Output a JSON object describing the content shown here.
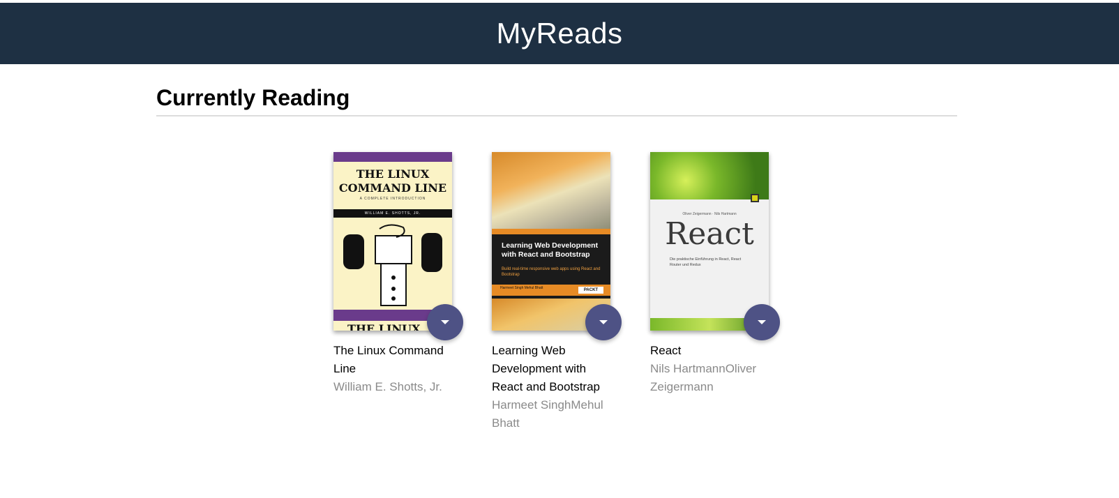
{
  "header": {
    "title": "MyReads"
  },
  "shelf": {
    "title": "Currently Reading",
    "books": [
      {
        "title": "The Linux Command Line",
        "authors": "William E. Shotts, Jr.",
        "cover": {
          "title_line1": "THE LINUX",
          "title_line2": "COMMAND LINE",
          "subtitle": "A COMPLETE INTRODUCTION",
          "author": "WILLIAM E. SHOTTS, JR.",
          "peek": "THE LINUX"
        }
      },
      {
        "title": "Learning Web Development with React and Bootstrap",
        "authors": "Harmeet SinghMehul Bhatt",
        "cover": {
          "title": "Learning Web Development with React and Bootstrap",
          "desc": "Build real-time responsive web apps using React and Bootstrap",
          "authors": "Harmeet Singh Mehul Bhatt",
          "publisher": "PACKT"
        }
      },
      {
        "title": "React",
        "authors": "Nils HartmannOliver Zeigermann",
        "cover": {
          "authors": "Oliver Zeigermann · Nils Hartmann",
          "title": "React",
          "desc": "Die praktische Einführung in React, React Router und Redux"
        }
      }
    ]
  },
  "colors": {
    "header_bg": "#1e3043",
    "shelf_changer": "#4e5285",
    "author_text": "#8a8a8a"
  }
}
